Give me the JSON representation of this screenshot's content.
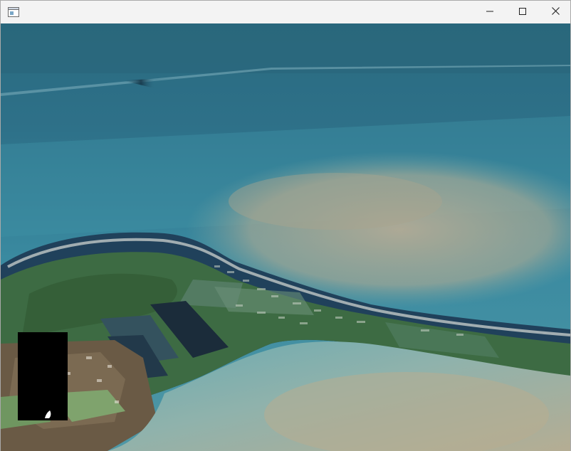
{
  "window": {
    "title": "",
    "icon": "window-app-icon",
    "controls": {
      "minimize_icon": "minimize-icon",
      "maximize_icon": "maximize-icon",
      "close_icon": "close-icon"
    }
  },
  "scene": {
    "description_icon": "aerial-3d-terrain-view",
    "colors": {
      "deep_sea": "#2f6f86",
      "shallow_sea": "#5fa3a8",
      "sand_water": "#a9a793",
      "land_green": "#3e6b40",
      "dark_field": "#1d2d3c"
    }
  },
  "minimap": {
    "marker_icon": "player-position-marker-icon",
    "background": "#000000"
  }
}
